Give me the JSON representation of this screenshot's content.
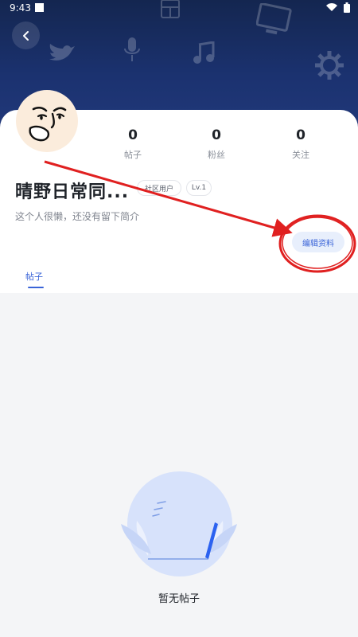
{
  "status_bar": {
    "time": "9:43"
  },
  "profile": {
    "username": "晴野日常同...",
    "badges": [
      "社区用户",
      "Lv.1"
    ],
    "bio": "这个人很懒，还没有留下简介",
    "edit_button_label": "编辑资料"
  },
  "stats": [
    {
      "value": "0",
      "label": "帖子"
    },
    {
      "value": "0",
      "label": "粉丝"
    },
    {
      "value": "0",
      "label": "关注"
    }
  ],
  "tabs": [
    {
      "label": "帖子",
      "active": true
    }
  ],
  "empty_state": {
    "text": "暂无帖子"
  },
  "icons": {
    "back": "back-arrow-icon",
    "status": [
      "notification-square-icon",
      "wifi-icon",
      "battery-icon"
    ]
  },
  "colors": {
    "header": "#1b3270",
    "accent": "#3a64d8",
    "annotation": "#e02020",
    "empty_circle": "#d7e2fb"
  }
}
